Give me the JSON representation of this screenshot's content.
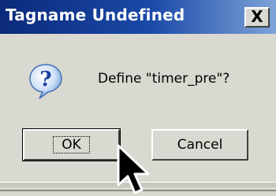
{
  "window": {
    "title": "Tagname Undefined",
    "close_glyph": "X"
  },
  "icon": {
    "name": "question-icon"
  },
  "message": "Define \"timer_pre\"?",
  "buttons": {
    "ok_label": "OK",
    "cancel_label": "Cancel"
  },
  "colors": {
    "titlebar_start": "#0b2a7a",
    "titlebar_end": "#7ea3d8",
    "dialog_bg": "#dad9d1"
  }
}
